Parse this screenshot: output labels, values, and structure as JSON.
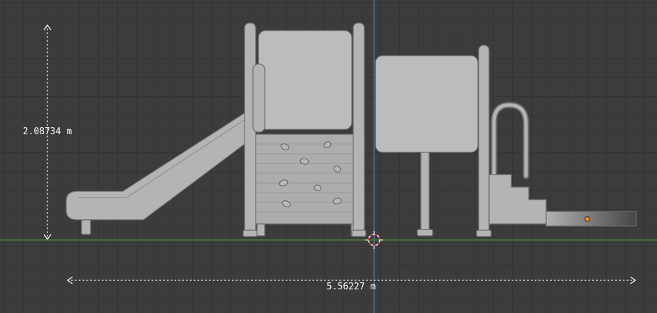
{
  "viewport": {
    "background_color": "#3c3c3c",
    "grid_color": "#343434",
    "axis_y_color": "#4f7d33",
    "axis_z_color": "#4a6fb0"
  },
  "rulers": {
    "height_label": "2.08734 m",
    "width_label": "5.56227 m",
    "line_color": "#ffffff"
  },
  "model": {
    "fill": "#b4b4b4",
    "panel_fill": "#bcbcbc",
    "wall_fill": "#adadad",
    "stroke": "#6b6b6b",
    "detail_line": "#8f8f8f",
    "plank_line": "#979797",
    "hold_fill": "#b8b8b8",
    "hold_stroke": "#5e5e5e",
    "ramp_near": "#b2b2b2",
    "ramp_far": "#454545",
    "origin_color": "#ff8a1f"
  },
  "cursor_3d": {
    "ring_red": "#cf3b3b",
    "ring_white": "#e9e9e9"
  }
}
